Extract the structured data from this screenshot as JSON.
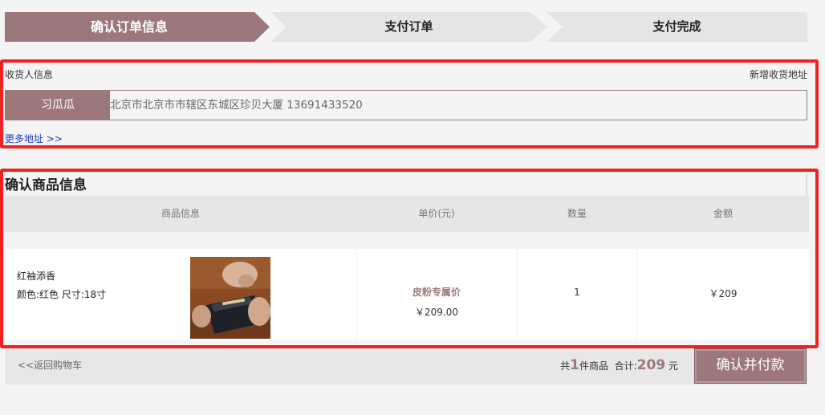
{
  "steps": [
    {
      "label": "确认订单信息",
      "active": true
    },
    {
      "label": "支付订单",
      "active": false
    },
    {
      "label": "支付完成",
      "active": false
    }
  ],
  "receiver": {
    "section_label": "收货人信息",
    "add_address_link": "新增收货地址",
    "name": "习瓜瓜",
    "address": "北京市北京市市辖区东城区珍贝大厦  13691433520",
    "more_address_link": "更多地址 >>"
  },
  "goods": {
    "title": "确认商品信息",
    "columns": [
      "商品信息",
      "单价(元)",
      "数量",
      "金额"
    ],
    "items": [
      {
        "name": "红袖添香",
        "spec": "颜色:红色  尺寸:18寸",
        "price_label": "皮粉专属价",
        "price": "￥209.00",
        "quantity": "1",
        "amount": "￥209"
      }
    ]
  },
  "footer": {
    "back_link": "<<返回购物车",
    "count_prefix": "共",
    "count": "1",
    "count_suffix": "件商品",
    "total_label": "合计:",
    "total": "209",
    "currency": "元",
    "pay_button": "确认并付款"
  },
  "colors": {
    "accent": "#9c787b",
    "highlight_border": "#ee2222",
    "link": "#1a3ccc"
  }
}
